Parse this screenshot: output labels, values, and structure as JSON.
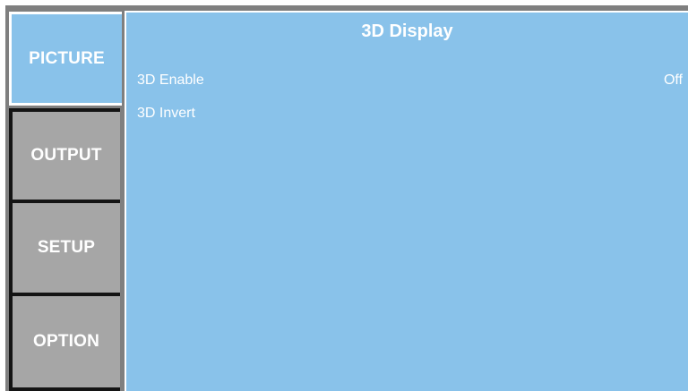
{
  "tabs": [
    {
      "label": "PICTURE",
      "active": true
    },
    {
      "label": "OUTPUT",
      "active": false
    },
    {
      "label": "SETUP",
      "active": false
    },
    {
      "label": "OPTION",
      "active": false
    }
  ],
  "panel": {
    "title": "3D Display",
    "items": [
      {
        "label": "3D Enable",
        "value": "Off"
      },
      {
        "label": "3D Invert",
        "value": ""
      }
    ]
  },
  "colors": {
    "active_tab": "#89c2ea",
    "inactive_tab": "#a6a6a6",
    "panel_background": "#89c2ea",
    "text": "#ffffff"
  }
}
